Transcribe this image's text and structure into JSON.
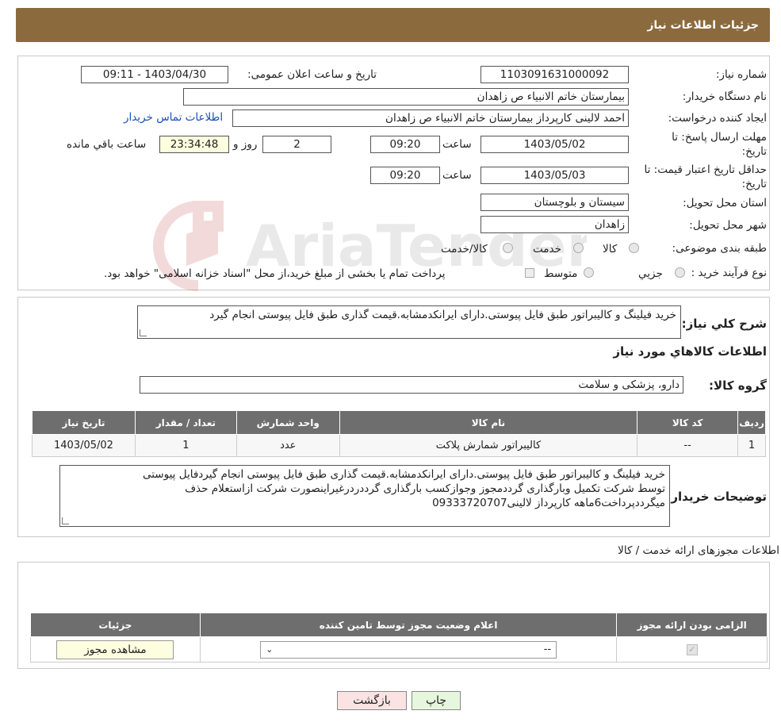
{
  "header": {
    "title": "جزئیات اطلاعات نیاز"
  },
  "form": {
    "need_number_label": "شماره نیاز:",
    "need_number": "1103091631000092",
    "announce_label": "تاریخ و ساعت اعلان عمومی:",
    "announce_value": "1403/04/30 - 09:11",
    "buyer_label": "نام دستگاه خریدار:",
    "buyer_value": "بیمارستان خاتم الانبیاء  ص  زاهدان",
    "creator_label": "ایجاد کننده درخواست:",
    "creator_value": "احمد لالینی کارپرداز بیمارستان خاتم الانبیاء  ص  زاهدان",
    "contact_link": "اطلاعات تماس خریدار",
    "deadline_label_1": "مهلت ارسال پاسخ: تا",
    "deadline_label_2": "تاریخ:",
    "deadline_date": "1403/05/02",
    "time_label": "ساعت",
    "deadline_time": "09:20",
    "days_value": "2",
    "days_label": "روز و",
    "remaining_time": "23:34:48",
    "remaining_label": "ساعت باقي مانده",
    "validity_label_1": "حداقل تاریخ اعتبار قیمت: تا",
    "validity_label_2": "تاریخ:",
    "validity_date": "1403/05/03",
    "validity_time": "09:20",
    "province_label": "استان محل تحویل:",
    "province_value": "سیستان و بلوچستان",
    "city_label": "شهر محل تحویل:",
    "city_value": "زاهدان",
    "category_label": "طبقه بندی موضوعی:",
    "category_options": [
      "کالا",
      "خدمت",
      "کالا/خدمت"
    ],
    "process_label": "نوع فرآیند خرید :",
    "process_options": [
      "جزیي",
      "متوسط"
    ],
    "process_note": "پرداخت تمام یا بخشی از مبلغ خرید،از محل \"اسناد خزانه اسلامی\" خواهد بود."
  },
  "description": {
    "label": "شرح کلي نياز:",
    "value": "خرید فیلینگ و کالیبراتور طبق فایل پیوستی.دارای ایرانکدمشابه.قیمت گذاری طبق فایل پیوستی انجام گیرد",
    "goods_title": "اطلاعات کالاهاي مورد نياز",
    "group_label": "گروه کالا:",
    "group_value": "دارو، پزشکی و سلامت"
  },
  "goods_table": {
    "headers": [
      "رديف",
      "کد کالا",
      "نام کالا",
      "واحد شمارش",
      "تعداد / مقدار",
      "تاریخ نیاز"
    ],
    "rows": [
      [
        "1",
        "--",
        "کالیبراتور شمارش پلاکت",
        "عدد",
        "1",
        "1403/05/02"
      ]
    ]
  },
  "buyer_notes": {
    "label": "توضیحات خریدار:",
    "lines": [
      "خرید فیلینگ و کالیبراتور طبق فایل پیوستی.دارای ایرانکدمشابه.قیمت گذاری طبق فایل پیوستی انجام گیردفایل پیوستی",
      "توسط شرکت تکمیل وبارگذاری گرددمجوز وجوازکسب بارگذاری گرددردرغیراینصورت شرکت ازاستعلام حذف",
      "میگرددپرداخت6ماهه کارپرداز لالینی09333720707"
    ]
  },
  "permits": {
    "title": "اطلاعات مجوزهای ارائه خدمت / کالا",
    "headers": [
      "الزامی بودن ارائه مجوز",
      "اعلام وضعیت مجوز توسط تامین کننده",
      "جزئیات"
    ],
    "select_value": "--",
    "view_button": "مشاهده مجوز"
  },
  "actions": {
    "print": "چاپ",
    "back": "بازگشت"
  },
  "watermark": {
    "text": "AriaTender.neT"
  },
  "colors": {
    "header": "#8b6a3e",
    "table_header": "#6e6e6e",
    "link": "#1a4fb5",
    "print_btn": "#e6f7dd",
    "back_btn": "#fbe3e3"
  }
}
